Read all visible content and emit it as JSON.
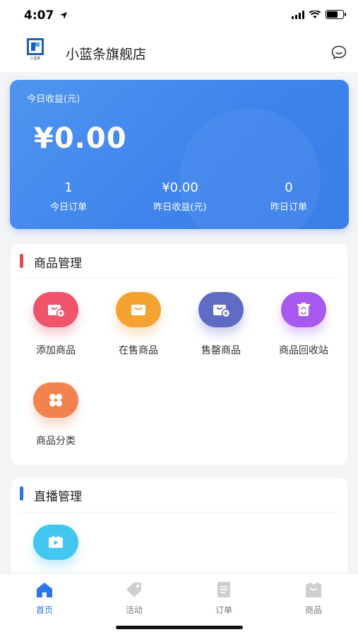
{
  "status_bar": {
    "time": "4:07"
  },
  "header": {
    "logo_text": "小蓝条",
    "store_name": "小蓝条旗舰店",
    "chat_icon": "chat-bubble-icon"
  },
  "earnings": {
    "label": "今日收益(元)",
    "amount": "¥0.00",
    "stats": [
      {
        "value": "1",
        "label": "今日订单"
      },
      {
        "value": "¥0.00",
        "label": "昨日收益(元)"
      },
      {
        "value": "0",
        "label": "昨日订单"
      }
    ]
  },
  "product_management": {
    "title": "商品管理",
    "accent": "#e94b4b",
    "items": [
      {
        "label": "添加商品",
        "icon": "add-product-icon",
        "color": "#f0546b"
      },
      {
        "label": "在售商品",
        "icon": "on-sale-bag-icon",
        "color": "#f4a232"
      },
      {
        "label": "售罄商品",
        "icon": "sold-out-bag-icon",
        "color": "#5e6cc4"
      },
      {
        "label": "商品回收站",
        "icon": "recycle-bin-icon",
        "color": "#a85af0"
      },
      {
        "label": "商品分类",
        "icon": "category-grid-icon",
        "color": "#f2824f"
      }
    ]
  },
  "live_management": {
    "title": "直播管理",
    "accent": "#2a76e8",
    "items": [
      {
        "label": "",
        "icon": "live-video-icon",
        "color": "#42c7f1"
      }
    ]
  },
  "tabbar": {
    "active_color": "#2a76e8",
    "tabs": [
      {
        "label": "首页",
        "icon": "home-icon",
        "active": true
      },
      {
        "label": "活动",
        "icon": "tag-icon",
        "active": false
      },
      {
        "label": "订单",
        "icon": "order-icon",
        "active": false
      },
      {
        "label": "商品",
        "icon": "product-icon",
        "active": false
      }
    ]
  }
}
